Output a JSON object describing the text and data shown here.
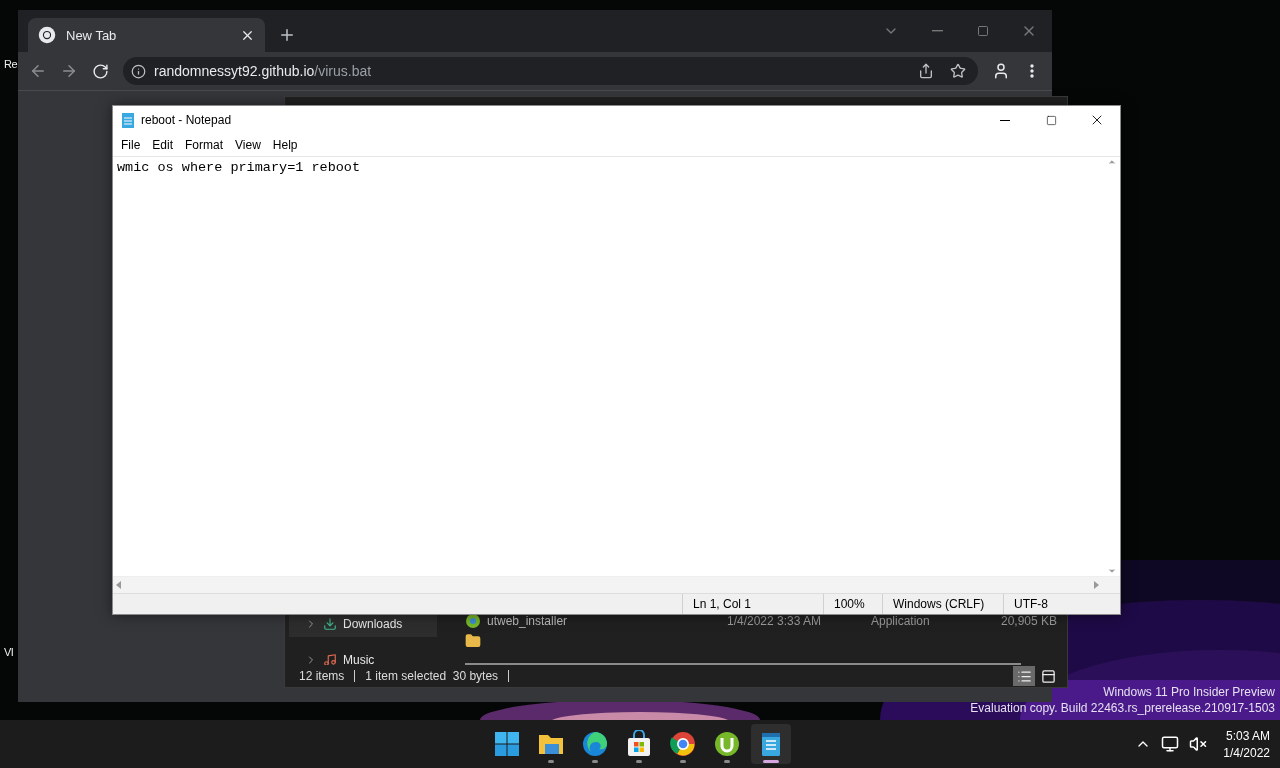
{
  "desktop": {
    "icons": [
      {
        "label": "Re"
      },
      {
        "label": "VI"
      }
    ],
    "watermark": [
      "Windows 11 Pro Insider Preview",
      "Evaluation copy. Build 22463.rs_prerelease.210917-1503"
    ]
  },
  "browser": {
    "tabs": [
      {
        "title": "New Tab",
        "selected": true
      }
    ],
    "url": {
      "host": "randomnessyt92.github.io",
      "path": "/virus.bat"
    }
  },
  "explorer": {
    "sidebar": [
      {
        "label": "Downloads",
        "kind": "downloads",
        "selected": true
      },
      {
        "label": "Music",
        "kind": "music",
        "selected": false
      }
    ],
    "rows": [
      {
        "name": "utweb_installer",
        "date": "1/4/2022 3:33 AM",
        "type": "Application",
        "size": "20,905 KB"
      }
    ],
    "status": [
      "12 items",
      "1 item selected  30 bytes"
    ]
  },
  "notepad": {
    "title": "reboot - Notepad",
    "menu": [
      "File",
      "Edit",
      "Format",
      "View",
      "Help"
    ],
    "text": "wmic os where primary=1 reboot",
    "status": [
      "Ln 1, Col 1",
      "100%",
      "Windows (CRLF)",
      "UTF-8"
    ]
  },
  "taskbar": {
    "apps": [
      {
        "kind": "start",
        "running": false,
        "active": false
      },
      {
        "kind": "files",
        "running": true,
        "active": false
      },
      {
        "kind": "edge",
        "running": true,
        "active": false
      },
      {
        "kind": "store",
        "running": true,
        "active": false
      },
      {
        "kind": "chrome",
        "running": true,
        "active": false
      },
      {
        "kind": "torrent",
        "running": true,
        "active": false
      },
      {
        "kind": "notepad",
        "running": true,
        "active": true
      }
    ],
    "clock": {
      "time": "5:03 AM",
      "date": "1/4/2022"
    }
  }
}
